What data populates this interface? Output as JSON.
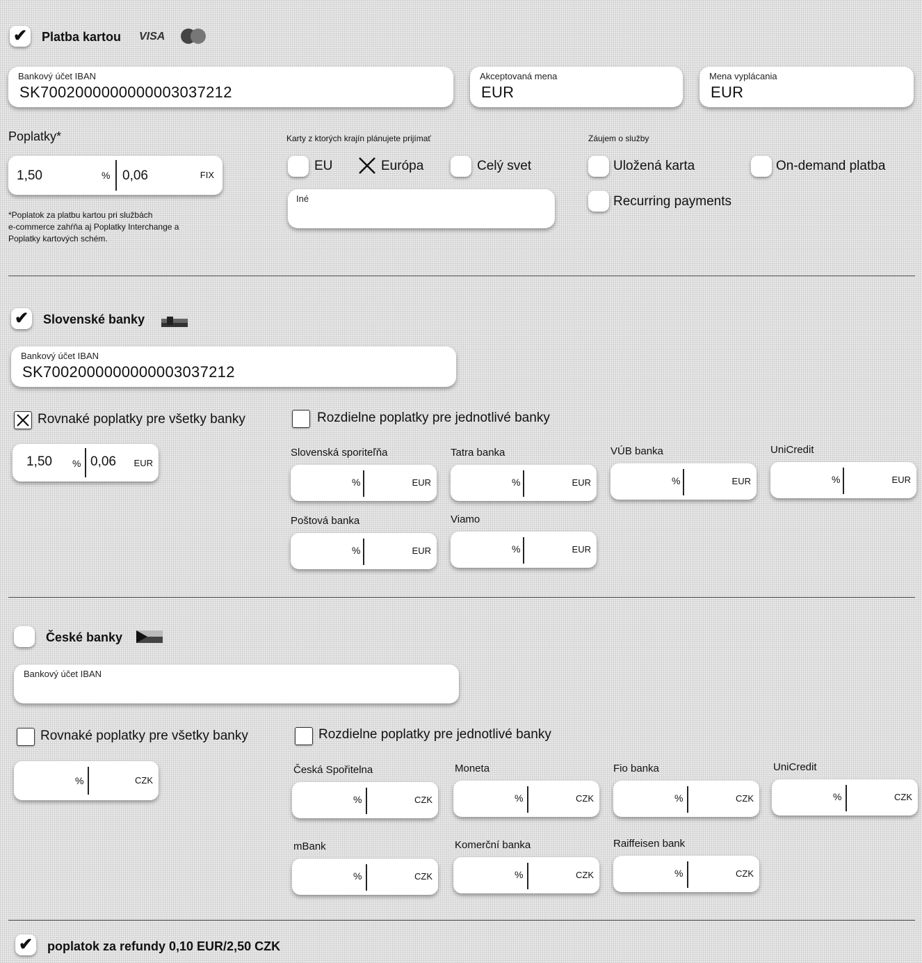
{
  "card": {
    "title": "Platba kartou",
    "visa": "VISA",
    "iban_label": "Bankový účet IBAN",
    "iban_value": "SK7002000000000003037212",
    "accepted_currency_label": "Akceptovaná mena",
    "accepted_currency_value": "EUR",
    "payout_currency_label": "Mena vyplácania",
    "payout_currency_value": "EUR",
    "fees_label": "Poplatky*",
    "fee_pct": "1,50",
    "fee_pct_unit": "%",
    "fee_fix": "0,06",
    "fee_fix_unit": "FIX",
    "footnote_1": "*Poplatok za platbu kartou pri službách",
    "footnote_2": "e-commerce zahŕňa aj Poplatky Interchange a",
    "footnote_3": "Poplatky kartových schém.",
    "regions_label": "Karty z ktorých krajín plánujete prijímať",
    "region_eu": "EU",
    "region_europe": "Európa",
    "region_world": "Celý svet",
    "other_label": "Iné",
    "services_label": "Záujem o služby",
    "service_saved": "Uložená karta",
    "service_ondemand": "On-demand platba",
    "service_recurring": "Recurring payments"
  },
  "sk": {
    "title": "Slovenské banky",
    "iban_label": "Bankový účet IBAN",
    "iban_value": "SK7002000000000003037212",
    "same_fees": "Rovnaké poplatky pre všetky banky",
    "diff_fees": "Rozdielne poplatky pre jednotlivé banky",
    "fee_pct": "1,50",
    "fee_fix": "0,06",
    "pct_unit": "%",
    "currency": "EUR",
    "banks": [
      "Slovenská sporiteľňa",
      "Tatra banka",
      "VÚB banka",
      "UniCredit",
      "Poštová banka",
      "Viamo"
    ]
  },
  "cz": {
    "title": "České banky",
    "iban_label": "Bankový účet IBAN",
    "same_fees": "Rovnaké poplatky pre všetky banky",
    "diff_fees": "Rozdielne poplatky pre jednotlivé banky",
    "pct_unit": "%",
    "currency": "CZK",
    "banks": [
      "Česká Spořitelna",
      "Moneta",
      "Fio banka",
      "UniCredit",
      "mBank",
      "Komerční banka",
      "Raiffeisen bank"
    ]
  },
  "refund": {
    "title": "poplatok za refundy 0,10 EUR/2,50 CZK"
  },
  "marks": {
    "check": "✔",
    "cross": "✕"
  }
}
